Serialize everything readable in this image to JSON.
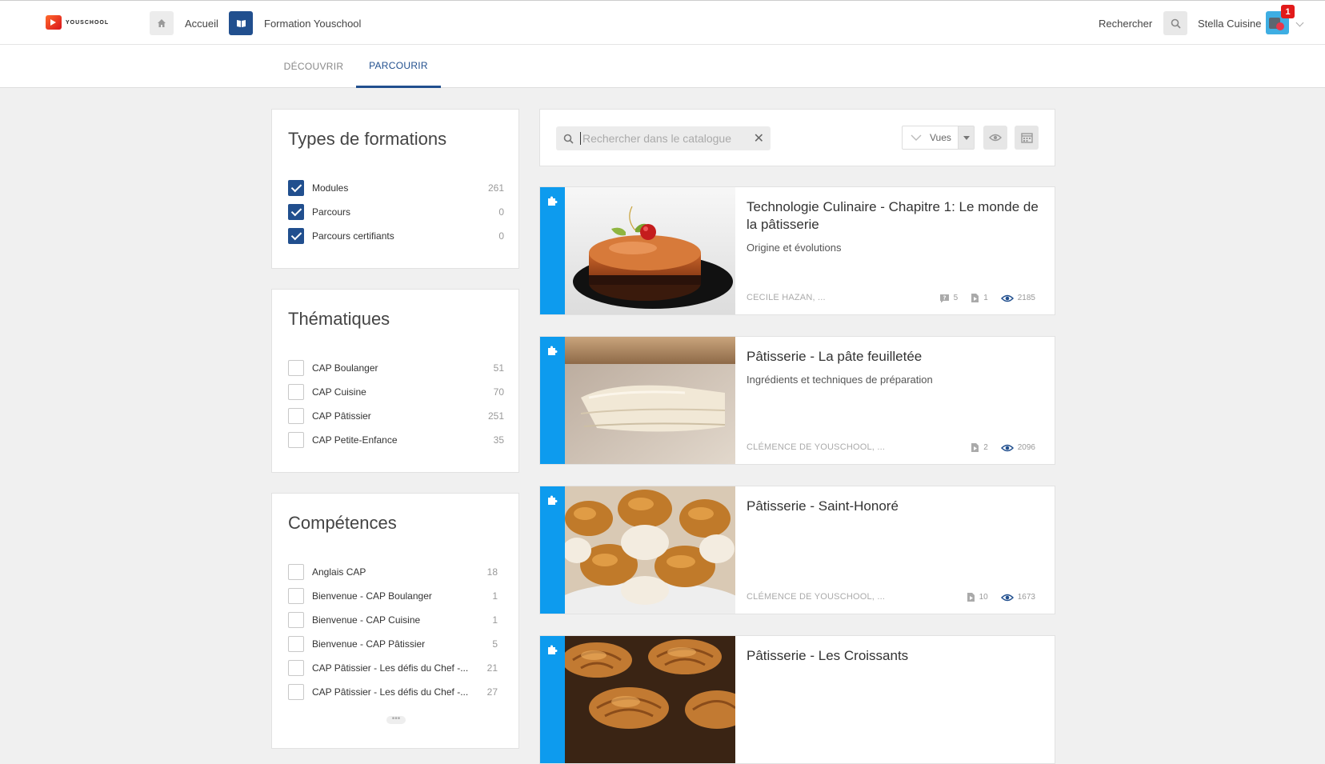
{
  "header": {
    "logo_text": "YOUSCHOOL",
    "nav": [
      {
        "label": "Accueil",
        "icon": "home-icon"
      },
      {
        "label": "Formation Youschool",
        "icon": "book-icon"
      }
    ],
    "search_label": "Rechercher",
    "user_name": "Stella Cuisine",
    "notification_count": "1"
  },
  "tabs": [
    {
      "label": "DÉCOUVRIR",
      "active": false
    },
    {
      "label": "PARCOURIR",
      "active": true
    }
  ],
  "filters": {
    "types": {
      "title": "Types de formations",
      "items": [
        {
          "label": "Modules",
          "count": "261",
          "checked": true
        },
        {
          "label": "Parcours",
          "count": "0",
          "checked": true
        },
        {
          "label": "Parcours certifiants",
          "count": "0",
          "checked": true
        }
      ]
    },
    "themes": {
      "title": "Thématiques",
      "items": [
        {
          "label": "CAP Boulanger",
          "count": "51",
          "checked": false
        },
        {
          "label": "CAP Cuisine",
          "count": "70",
          "checked": false
        },
        {
          "label": "CAP Pâtissier",
          "count": "251",
          "checked": false
        },
        {
          "label": "CAP Petite-Enfance",
          "count": "35",
          "checked": false
        }
      ]
    },
    "skills": {
      "title": "Compétences",
      "items": [
        {
          "label": "Anglais CAP",
          "count": "18",
          "checked": false
        },
        {
          "label": "Bienvenue - CAP Boulanger",
          "count": "1",
          "checked": false
        },
        {
          "label": "Bienvenue - CAP Cuisine",
          "count": "1",
          "checked": false
        },
        {
          "label": "Bienvenue - CAP Pâtissier",
          "count": "5",
          "checked": false
        },
        {
          "label": "CAP Pâtissier - Les défis du Chef -...",
          "count": "21",
          "checked": false
        },
        {
          "label": "CAP Pâtissier - Les défis du Chef -...",
          "count": "27",
          "checked": false
        }
      ],
      "more": "•••"
    }
  },
  "catalog": {
    "search_placeholder": "Rechercher dans le catalogue",
    "views_label": "Vues"
  },
  "courses": [
    {
      "title": "Technologie Culinaire - Chapitre 1: Le monde de la pâtisserie",
      "subtitle": "Origine et évolutions",
      "author": "CECILE HAZAN, ...",
      "quiz": "5",
      "videos": "1",
      "views": "2185",
      "image": "chocolate-entremet-cake"
    },
    {
      "title": "Pâtisserie - La pâte feuilletée",
      "subtitle": "Ingrédients et techniques de préparation",
      "author": "CLÉMENCE DE YOUSCHOOL, ...",
      "quiz": "",
      "videos": "2",
      "views": "2096",
      "image": "puff-pastry-dough"
    },
    {
      "title": "Pâtisserie - Saint-Honoré",
      "subtitle": "",
      "author": "CLÉMENCE DE YOUSCHOOL, ...",
      "quiz": "",
      "videos": "10",
      "views": "1673",
      "image": "saint-honore-choux"
    },
    {
      "title": "Pâtisserie - Les Croissants",
      "subtitle": "",
      "author": "",
      "quiz": "",
      "videos": "",
      "views": "",
      "image": "croissants"
    }
  ]
}
